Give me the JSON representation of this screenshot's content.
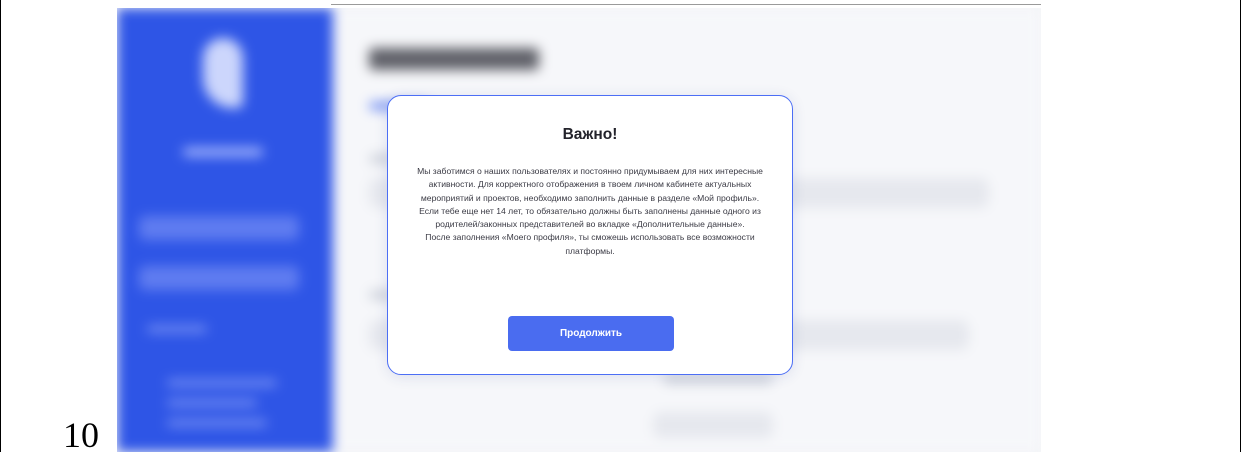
{
  "document": {
    "line_number": "10"
  },
  "modal": {
    "title": "Важно!",
    "paragraphs": [
      "Мы заботимся о наших пользователях и постоянно придумываем для них интересные активности. Для корректного отображения в твоем личном кабинете актуальных мероприятий и проектов, необходимо заполнить данные в разделе «Мой профиль».",
      "Если тебе еще нет 14 лет, то обязательно должны быть заполнены данные одного из родителей/законных представителей во вкладке «Дополнительные данные».",
      "После заполнения «Моего профиля», ты сможешь использовать все возможности платформы."
    ],
    "continue_label": "Продолжить"
  },
  "colors": {
    "accent": "#4a6cf0",
    "sidebar": "#2e55e6",
    "modal_border": "#4c6ef5"
  }
}
